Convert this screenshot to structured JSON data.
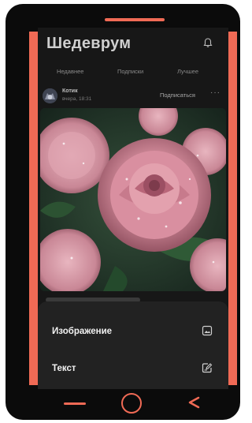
{
  "app": {
    "title": "Шедеврум"
  },
  "tabs": [
    "Недавнее",
    "Подписки",
    "Лучшее"
  ],
  "post": {
    "author": "Котик",
    "time": "вчера, 18:31",
    "subscribe_label": "Подписаться",
    "more": "···"
  },
  "sheet": {
    "items": [
      {
        "label": "Изображение",
        "icon": "image-icon"
      },
      {
        "label": "Текст",
        "icon": "edit-text-icon"
      }
    ]
  },
  "colors": {
    "accent": "#f06a55",
    "screen_bg": "#171717",
    "sheet_bg": "#222222"
  }
}
